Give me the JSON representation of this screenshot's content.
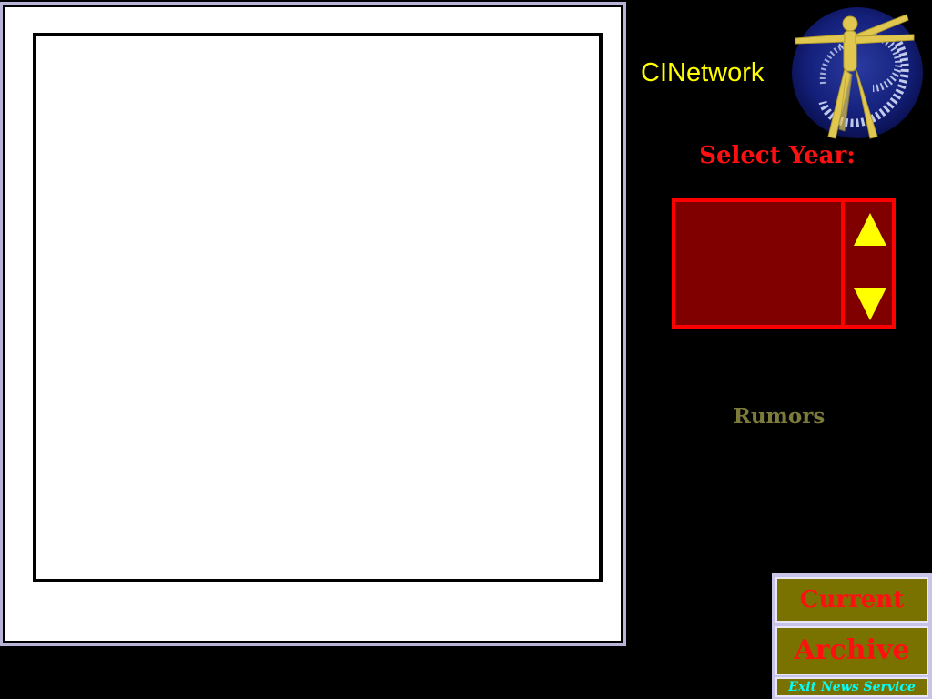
{
  "brand": {
    "title": "CINetwork",
    "logo_icon": "vitruvian-man-logo"
  },
  "year_selector": {
    "label": "Select Year:",
    "selected_value": "",
    "up_icon": "triangle-up-icon",
    "down_icon": "triangle-down-icon"
  },
  "links": {
    "rumors": "Rumors"
  },
  "nav": {
    "current": "Current",
    "archive": "Archive",
    "exit": "Exit News Service"
  },
  "colors": {
    "background": "#000000",
    "brand": "#ffff00",
    "accent_red": "#ff0000",
    "year_box_fill": "#800000",
    "arrow": "#ffff00",
    "rumors": "#7d7b3a",
    "nav_button": "#7a7200",
    "exit_text": "#00ffff"
  }
}
